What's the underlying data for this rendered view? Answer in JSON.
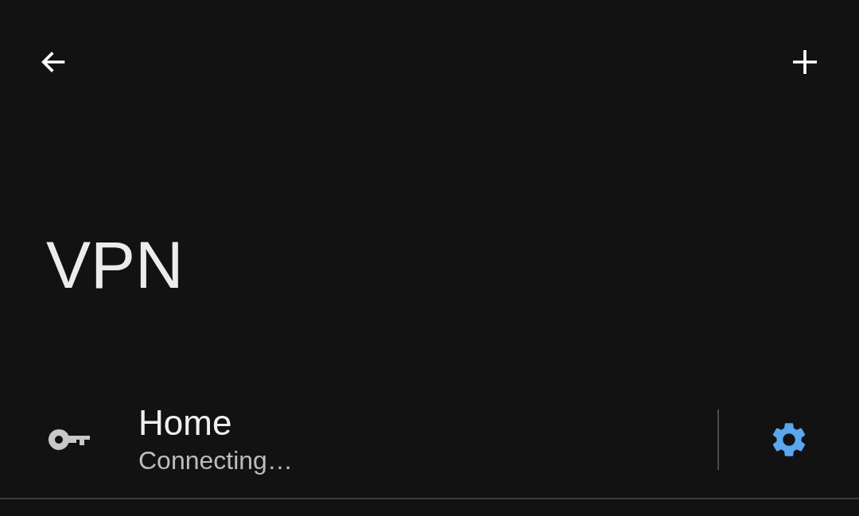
{
  "title": "VPN",
  "vpns": [
    {
      "name": "Home",
      "status": "Connecting…"
    }
  ]
}
